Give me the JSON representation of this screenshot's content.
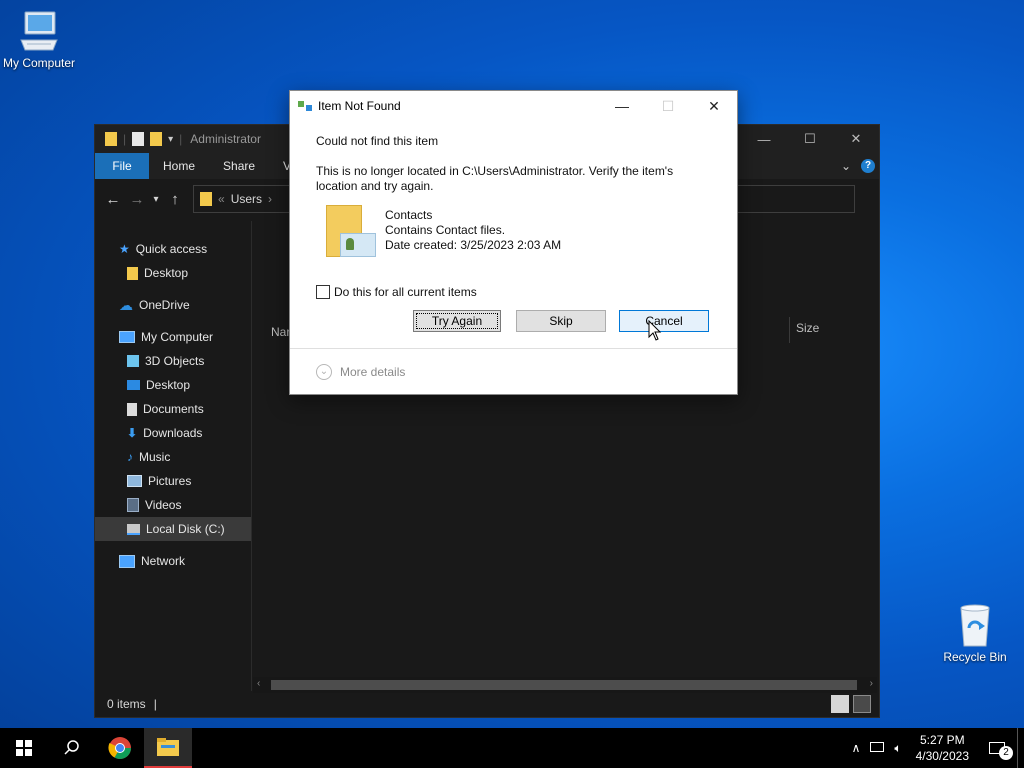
{
  "desktop": {
    "icons": [
      {
        "label": "My Computer"
      },
      {
        "label": "Recycle Bin"
      }
    ]
  },
  "explorer": {
    "title": "Administrator",
    "ribbon_tabs": [
      "File",
      "Home",
      "Share",
      "V"
    ],
    "address": {
      "chevron": "«",
      "crumb": "Users",
      "separator": "›"
    },
    "nav": [
      {
        "label": "Quick access",
        "icon": "star-icon"
      },
      {
        "label": "Desktop",
        "icon": "folder-icon"
      },
      {
        "label": "OneDrive",
        "icon": "cloud-icon"
      },
      {
        "label": "My Computer",
        "icon": "computer-icon"
      },
      {
        "label": "3D Objects",
        "icon": "cube-icon"
      },
      {
        "label": "Desktop",
        "icon": "desktop-icon"
      },
      {
        "label": "Documents",
        "icon": "document-icon"
      },
      {
        "label": "Downloads",
        "icon": "download-icon"
      },
      {
        "label": "Music",
        "icon": "music-icon"
      },
      {
        "label": "Pictures",
        "icon": "pictures-icon"
      },
      {
        "label": "Videos",
        "icon": "videos-icon"
      },
      {
        "label": "Local Disk (C:)",
        "icon": "drive-icon"
      },
      {
        "label": "Network",
        "icon": "network-icon"
      }
    ],
    "columns": {
      "name": "Nar",
      "size": "Size"
    },
    "status": {
      "items": "0 items",
      "divider": "|"
    }
  },
  "dialog": {
    "title": "Item Not Found",
    "heading": "Could not find this item",
    "message_line1": "This is no longer located in C:\\Users\\Administrator. Verify the item's",
    "message_line2": "location and try again.",
    "item": {
      "name": "Contacts",
      "description": "Contains Contact files.",
      "date": "Date created: 3/25/2023 2:03 AM"
    },
    "checkbox_label": "Do this for all current items",
    "buttons": {
      "try_again": "Try Again",
      "skip": "Skip",
      "cancel": "Cancel"
    },
    "more_details": "More details"
  },
  "taskbar": {
    "time": "5:27 PM",
    "date": "4/30/2023",
    "notification_count": "2"
  },
  "colors": {
    "accent": "#0078d7",
    "file_tab": "#1b6fb8",
    "explorer_bg": "#191919"
  }
}
